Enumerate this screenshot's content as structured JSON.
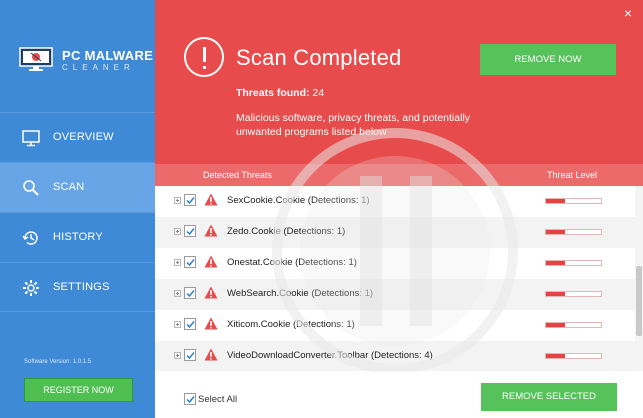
{
  "app": {
    "name": "PC MALWARE",
    "subtitle": "CLEANER",
    "version": "Software Version:  1.0.1.5"
  },
  "sidebar": {
    "items": [
      {
        "label": "OVERVIEW",
        "icon": "monitor-icon"
      },
      {
        "label": "SCAN",
        "icon": "search-icon"
      },
      {
        "label": "HISTORY",
        "icon": "history-icon"
      },
      {
        "label": "SETTINGS",
        "icon": "gear-icon"
      }
    ],
    "active": "SCAN",
    "register_label": "REGISTER NOW"
  },
  "header": {
    "title": "Scan Completed",
    "threats_found_label": "Threats found:",
    "threats_found_count": "24",
    "description": "Malicious software, privacy threats, and potentially unwanted programs listed below",
    "remove_now_label": "REMOVE NOW",
    "close_symbol": "×"
  },
  "table": {
    "col_threats": "Detected Threats",
    "col_level": "Threat Level",
    "rows": [
      {
        "label": "SexCookie.Cookie (Detections: 1)",
        "checked": true,
        "level": 0.35
      },
      {
        "label": "Zedo.Cookie (Detections: 1)",
        "checked": true,
        "level": 0.35
      },
      {
        "label": "Onestat.Cookie (Detections: 1)",
        "checked": true,
        "level": 0.35
      },
      {
        "label": "WebSearch.Cookie (Detections: 1)",
        "checked": true,
        "level": 0.35
      },
      {
        "label": "Xiticom.Cookie (Detections: 1)",
        "checked": true,
        "level": 0.35
      },
      {
        "label": "VideoDownloadConverter.Toolbar (Detections: 4)",
        "checked": true,
        "level": 0.35
      }
    ]
  },
  "footer": {
    "select_all_label": "Select All",
    "remove_selected_label": "REMOVE SELECTED"
  },
  "colors": {
    "sidebar": "#3f8ad6",
    "header": "#e84b4b",
    "accent_green": "#55c25a",
    "threat_red": "#e54242"
  }
}
